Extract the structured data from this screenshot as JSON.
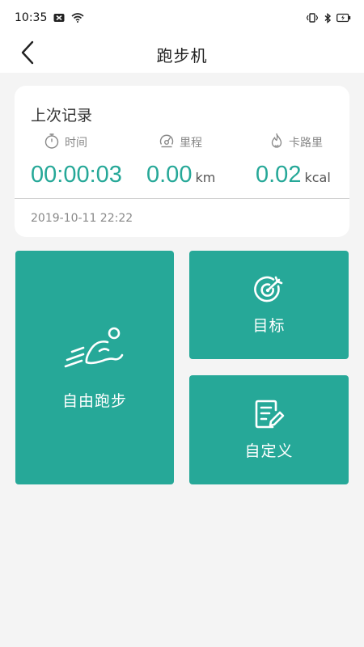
{
  "status_bar": {
    "time": "10:35",
    "icons": [
      "sim-card-blocked-icon",
      "wifi-icon",
      "vibrate-icon",
      "bluetooth-icon",
      "battery-icon"
    ]
  },
  "app_bar": {
    "title": "跑步机",
    "back_icon": "chevron-left-icon"
  },
  "last_record": {
    "title": "上次记录",
    "metrics": [
      {
        "label": "时间",
        "icon": "stopwatch-icon",
        "value": "00:00:03",
        "unit": ""
      },
      {
        "label": "里程",
        "icon": "distance-icon",
        "value": "0.00",
        "unit": "km"
      },
      {
        "label": "卡路里",
        "icon": "flame-icon",
        "value": "0.02",
        "unit": "kcal"
      }
    ],
    "date": "2019-10-11 22:22"
  },
  "modes": {
    "free_run": {
      "label": "自由跑步",
      "icon": "runner-icon"
    },
    "target": {
      "label": "目标",
      "icon": "target-icon"
    },
    "custom": {
      "label": "自定义",
      "icon": "edit-document-icon"
    }
  },
  "colors": {
    "accent": "#26a898",
    "background": "#f4f4f4",
    "card": "#ffffff"
  }
}
